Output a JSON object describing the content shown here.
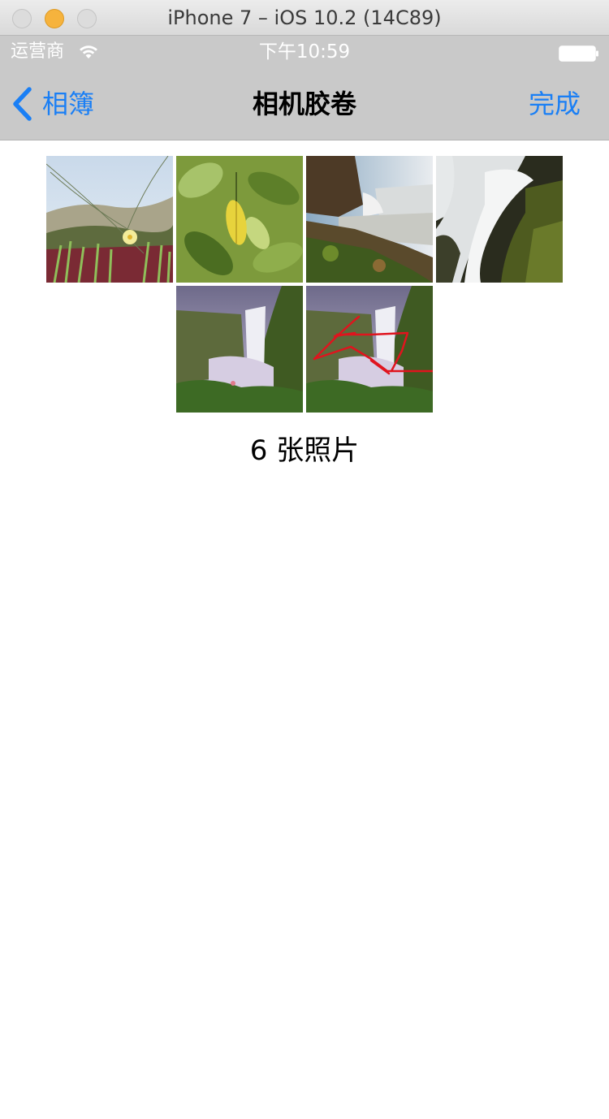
{
  "window": {
    "title": "iPhone 7 – iOS 10.2 (14C89)"
  },
  "status_bar": {
    "carrier": "运营商",
    "time": "下午10:59",
    "icons": [
      "wifi-icon",
      "battery-icon"
    ]
  },
  "nav_bar": {
    "back_label": "相簿",
    "title": "相机胶卷",
    "done_label": "完成",
    "accent_color": "#1a7ff5"
  },
  "photos": [
    {
      "description_icon": "flower-dune-photo"
    },
    {
      "description_icon": "yellow-leaf-photo"
    },
    {
      "description_icon": "waterfall-valley-photo"
    },
    {
      "description_icon": "waterfall-rocks-photo"
    },
    {
      "description_icon": "waterfall-cliff-photo"
    },
    {
      "description_icon": "waterfall-cliff-drawn-photo"
    }
  ],
  "footer": {
    "count_label": "6 张照片"
  }
}
